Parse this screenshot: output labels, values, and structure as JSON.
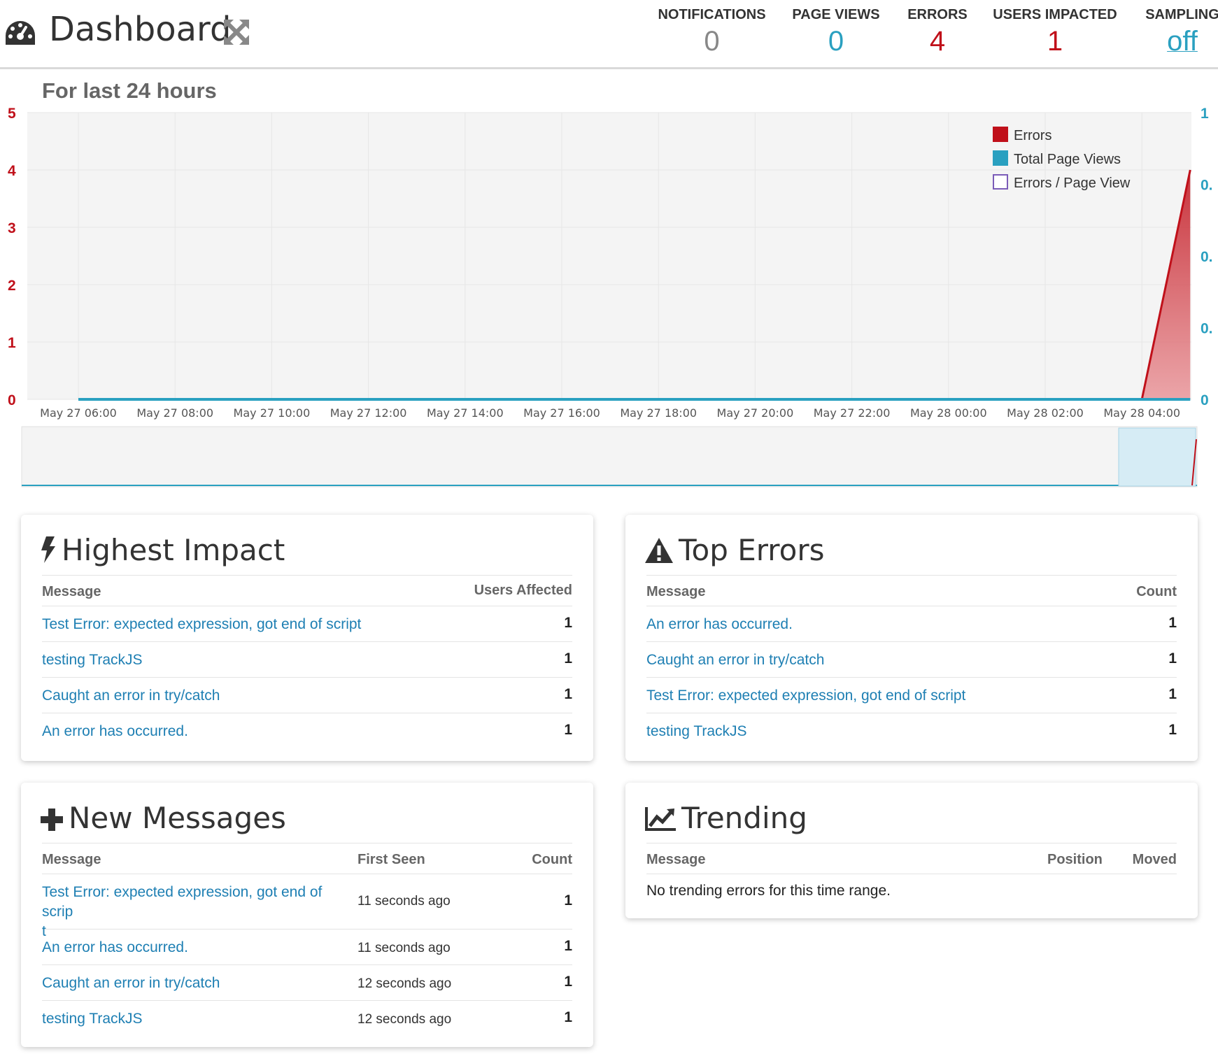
{
  "header": {
    "title": "Dashboard",
    "stats": [
      {
        "label": "NOTIFICATIONS",
        "value": "0",
        "color": "#888888"
      },
      {
        "label": "PAGE VIEWS",
        "value": "0",
        "color": "#2aa0c0"
      },
      {
        "label": "ERRORS",
        "value": "4",
        "color": "#c0101a"
      },
      {
        "label": "USERS IMPACTED",
        "value": "1",
        "color": "#c0101a"
      },
      {
        "label": "SAMPLING",
        "value": "off",
        "color": "#2aa0c0"
      }
    ]
  },
  "chart_data": {
    "type": "area",
    "title": "For last 24 hours",
    "categories": [
      "May 27 06:00",
      "May 27 08:00",
      "May 27 10:00",
      "May 27 12:00",
      "May 27 14:00",
      "May 27 16:00",
      "May 27 18:00",
      "May 27 20:00",
      "May 27 22:00",
      "May 28 00:00",
      "May 28 02:00",
      "May 28 04:00"
    ],
    "y_left_ticks": [
      "0",
      "1",
      "2",
      "3",
      "4",
      "5"
    ],
    "y_right_ticks": [
      "0",
      "0.",
      "0.",
      "0.",
      "1"
    ],
    "ylim_left": [
      0,
      5
    ],
    "ylim_right": [
      0,
      1
    ],
    "legend": [
      "Errors",
      "Total Page Views",
      "Errors / Page View"
    ],
    "legend_placement": "top-right",
    "series": [
      {
        "name": "Errors",
        "color": "#c0101a",
        "points": [
          [
            "May 28 04:00",
            0
          ],
          [
            "May 28 05:00",
            4
          ]
        ]
      },
      {
        "name": "Total Page Views",
        "color": "#2aa0c0",
        "points": [
          [
            "May 27 06:00",
            0
          ],
          [
            "May 28 05:00",
            0
          ]
        ]
      },
      {
        "name": "Errors / Page View",
        "color": "#7b5cb8",
        "points": []
      }
    ]
  },
  "panels": {
    "highest_impact": {
      "title": "Highest Impact",
      "col_message": "Message",
      "col_users": "Users Affected",
      "rows": [
        {
          "message": "Test Error: expected expression, got end of script",
          "value": "1"
        },
        {
          "message": "testing TrackJS",
          "value": "1"
        },
        {
          "message": "Caught an error in try/catch",
          "value": "1"
        },
        {
          "message": "An error has occurred.",
          "value": "1"
        }
      ]
    },
    "top_errors": {
      "title": "Top Errors",
      "col_message": "Message",
      "col_count": "Count",
      "rows": [
        {
          "message": "An error has occurred.",
          "value": "1"
        },
        {
          "message": "Caught an error in try/catch",
          "value": "1"
        },
        {
          "message": "Test Error: expected expression, got end of script",
          "value": "1"
        },
        {
          "message": "testing TrackJS",
          "value": "1"
        }
      ]
    },
    "new_messages": {
      "title": "New Messages",
      "col_message": "Message",
      "col_first_seen": "First Seen",
      "col_count": "Count",
      "rows": [
        {
          "message_line1": "Test Error: expected expression, got end of scrip",
          "message_line2": "t",
          "first_seen": "11 seconds ago",
          "value": "1"
        },
        {
          "message": "An error has occurred.",
          "first_seen": "11 seconds ago",
          "value": "1"
        },
        {
          "message": "Caught an error in try/catch",
          "first_seen": "12 seconds ago",
          "value": "1"
        },
        {
          "message": "testing TrackJS",
          "first_seen": "12 seconds ago",
          "value": "1"
        }
      ]
    },
    "trending": {
      "title": "Trending",
      "col_message": "Message",
      "col_position": "Position",
      "col_moved": "Moved",
      "empty": "No trending errors for this time range."
    }
  }
}
